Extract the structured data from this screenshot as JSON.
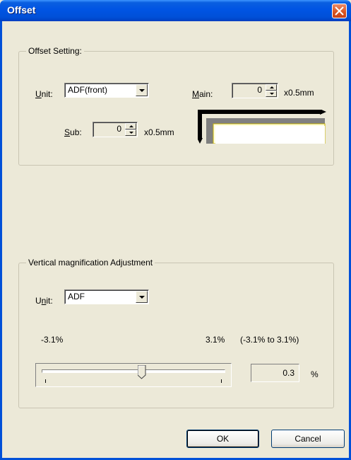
{
  "window": {
    "title": "Offset"
  },
  "offset_setting": {
    "group_label": "Offset Setting:",
    "unit_label_u": "U",
    "unit_label_rest": "nit:",
    "unit_value": "ADF(front)",
    "main_label_m": "M",
    "main_label_rest": "ain:",
    "main_value": "0",
    "main_unit": "x0.5mm",
    "sub_label_s": "S",
    "sub_label_rest": "ub:",
    "sub_value": "0",
    "sub_unit": "x0.5mm"
  },
  "vertical_adjustment": {
    "group_label": "Vertical magnification Adjustment",
    "unit_label_pre": "U",
    "unit_label_n": "n",
    "unit_label_rest": "it:",
    "unit_value": "ADF",
    "min_label": "-3.1%",
    "max_label": "3.1%",
    "range_label": "(-3.1% to 3.1%)",
    "value": "0.3",
    "percent": "%",
    "slider_fraction": 0.55
  },
  "buttons": {
    "ok": "OK",
    "cancel": "Cancel"
  }
}
